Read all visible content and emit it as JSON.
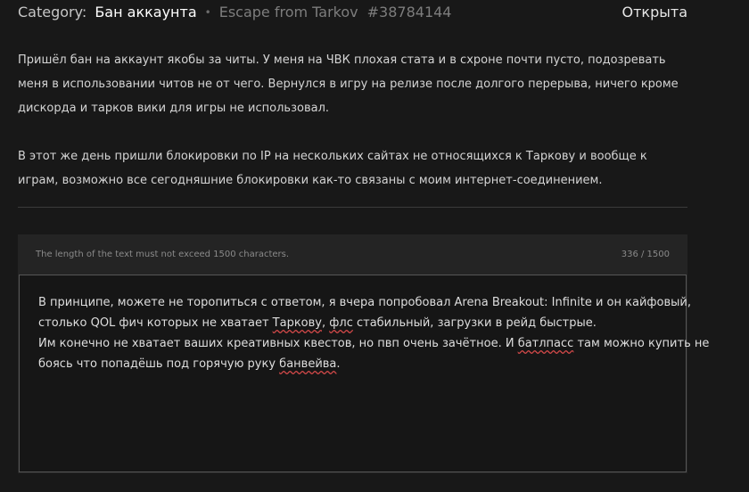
{
  "header": {
    "category_label": "Category:",
    "category_value": "Бан аккаунта",
    "separator": "•",
    "game": "Escape from Tarkov",
    "ticket_id": "#38784144",
    "status": "Открыта"
  },
  "message": {
    "paragraph_1": "Пришёл бан на аккаунт якобы за читы. У меня на ЧВК плохая стата и в схроне почти пусто, подозревать меня в использовании читов не от чего. Вернулся в игру на релизе после долгого перерыва, ничего кроме дискорда и тарков вики для игры не использовал.",
    "paragraph_2": "В этот же день пришли блокировки по IP на нескольких сайтах не относящихся к Таркову и вообще к играм, возможно все сегодняшние блокировки как-то связаны с моим интернет-соединением."
  },
  "reply": {
    "limit_hint": "The length of the text must not exceed 1500 characters.",
    "counter": "336 / 1500",
    "text_lines": [
      [
        "В принципе, можете не торопиться с ответом, я вчера попробовал Arena Breakout: Infinite и он кайфовый,"
      ],
      [
        "столько QOL фич которых не хватает ",
        "Таркову",
        ", ",
        "флс",
        " стабильный, загрузки в рейд быстрые."
      ],
      [
        "Им конечно не хватает ваших креативных квестов, но пвп очень зачётное. И ",
        "батлпасс",
        " там можно купить не"
      ],
      [
        "боясь что попадёшь под горячую руку ",
        "банвейва",
        "."
      ]
    ]
  },
  "colors": {
    "background": "#181818",
    "panel": "#242424",
    "textarea": "#161616",
    "spellcheck_underline": "#d04848"
  }
}
